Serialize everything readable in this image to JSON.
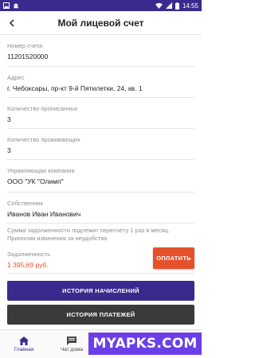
{
  "status_bar": {
    "time": "14:55"
  },
  "header": {
    "title": "Мой лицевой счет"
  },
  "account": {
    "number_label": "Номер счета",
    "number_value": "11201520000",
    "address_label": "Адрес",
    "address_value": "г. Чебоксары, пр-кт 9-й Пятилетки, 24, кв. 1",
    "registered_label": "Количество прописанных",
    "registered_value": "3",
    "residents_label": "Количество проживающих",
    "residents_value": "3",
    "company_label": "Управляющая компания",
    "company_value": "ООО \"УК \"Олимп\"",
    "owner_label": "Собственник",
    "owner_value": "Иванов Иван Иванович"
  },
  "note": "Сумма задолженности подлежит пересчёту 1 раз в месяц. Приносим извинения за неудобства",
  "debt": {
    "label": "Задолженность",
    "value": "1 395,69 руб.",
    "pay_label": "ОПЛАТИТЬ"
  },
  "buttons": {
    "charges_history": "ИСТОРИЯ НАЧИСЛЕНИЙ",
    "payments_history": "ИСТОРИЯ ПЛАТЕЖЕЙ"
  },
  "bottom_nav": {
    "home": "Главная",
    "chat": "Чат дома"
  },
  "watermark": "MYAPKS.COM",
  "colors": {
    "primary": "#3b2a8d",
    "accent": "#e5512b",
    "dark_button": "#3a3a3a",
    "watermark": "#6a3fe8"
  },
  "icons": [
    "image-icon",
    "android-icon",
    "wifi-icon",
    "signal-icon",
    "battery-icon",
    "back-arrow-icon",
    "home-icon",
    "chat-icon"
  ]
}
